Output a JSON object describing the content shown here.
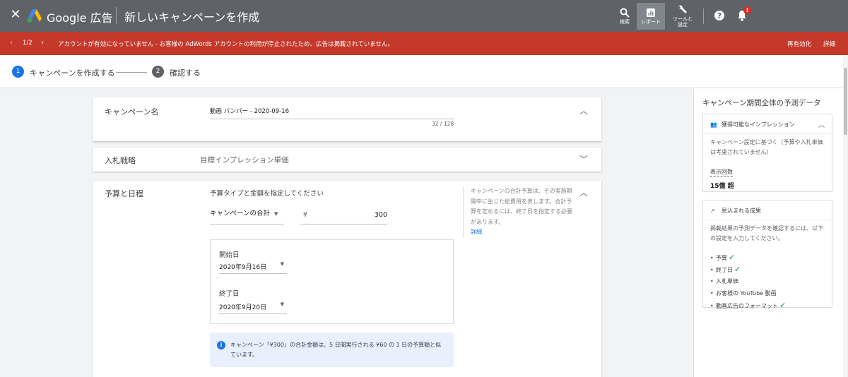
{
  "header": {
    "close_label": "✕",
    "brand": "Google 広告",
    "page_title": "新しいキャンペーンを作成",
    "search_label": "検索",
    "report_label": "レポート",
    "tools_label_1": "ツールと",
    "tools_label_2": "設定",
    "notification_badge": "!"
  },
  "alert": {
    "prev": "‹",
    "count": "1/2",
    "next": "›",
    "message": "アカウントが有効になっていません - お客様の AdWords アカウントの利用が停止されたため、広告は掲載されていません。",
    "action_reactivate": "再有効化",
    "action_details": "詳細",
    "color": "#c5392b"
  },
  "stepper": {
    "step1_num": "1",
    "step1_label": "キャンペーンを作成する",
    "step2_num": "2",
    "step2_label": "確認する"
  },
  "campaign_name": {
    "title": "キャンペーン名",
    "value": "動画 バンパー - 2020-09-16",
    "counter": "32 / 128"
  },
  "bidding": {
    "title": "入札戦略",
    "value": "目標インプレッション単価"
  },
  "budget": {
    "title": "予算と日程",
    "prompt": "予算タイプと金額を指定してください",
    "type_value": "キャンペーンの合計",
    "currency": "¥",
    "amount": "300",
    "help_text": "キャンペーンの合計予算は、その実施期間中に生じた総費用を表します。合計予算を定めるには、終了日を指定する必要があります。",
    "help_link": "詳細",
    "start_label": "開始日",
    "start_value": "2020年9月16日",
    "end_label": "終了日",
    "end_value": "2020年9月20日",
    "info_text": "キャンペーン「¥300」の合計金額は、5 日間実行される ¥60 の 1 日の予算額と似ています。"
  },
  "forecast": {
    "title": "キャンペーン期間全体の予測データ",
    "impressions_heading": "獲得可能なインプレッション",
    "impressions_note": "キャンペーン設定に基づく（予算や入札単価は考慮されていません）",
    "impressions_label": "表示回数",
    "impressions_value": "15億 超",
    "results_heading": "見込まれる成果",
    "results_note": "掲載結果の予測データを確認するには、以下の設定を入力してください。",
    "requirements": [
      {
        "label": "予算",
        "done": true
      },
      {
        "label": "終了日",
        "done": true
      },
      {
        "label": "入札単価",
        "done": false
      },
      {
        "label": "お客様の YouTube 動画",
        "done": false
      },
      {
        "label": "動画広告のフォーマット",
        "done": true
      }
    ]
  },
  "icons": {
    "search": "search-icon",
    "report": "bar-chart-icon",
    "tools": "wrench-icon",
    "help": "help-icon",
    "bell": "bell-icon",
    "info": "info-icon",
    "people": "people-icon",
    "trend": "trending-up-icon",
    "check": "check-icon"
  }
}
